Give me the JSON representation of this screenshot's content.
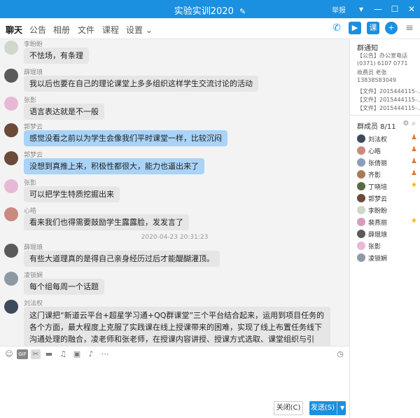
{
  "window": {
    "title": "实验实训2020",
    "report_label": "举报",
    "minimize": "—",
    "maximize": "☐",
    "close": "✕"
  },
  "tabs": [
    {
      "label": "聊天"
    },
    {
      "label": "公告"
    },
    {
      "label": "相册"
    },
    {
      "label": "文件"
    },
    {
      "label": "课程"
    },
    {
      "label": "设置 ⌄"
    }
  ],
  "messages": [
    {
      "sender": "李盼盼",
      "text": "不怯场，有条理"
    },
    {
      "sender": "薛琨琅",
      "text": "我以后也要在自己的理论课堂上多多组织这样学生交流讨论的活动"
    },
    {
      "sender": "张影",
      "text": "语言表达就是不一般"
    },
    {
      "sender": "郭梦云",
      "text": "感觉没看之前以为学生会像我们平时课堂一样，比较沉闷"
    },
    {
      "sender": "郭梦云",
      "text": "没想到真推上来，积极性都很大，能力也逼出来了"
    },
    {
      "sender": "张影",
      "text": "可以把学生特质挖掘出来"
    },
    {
      "sender": "心皓",
      "text": "看来我们也得需要鼓励学生露露脸，发发言了"
    },
    {
      "sender": "薛琨琅",
      "text": "有些大道理真的是得自己亲身经历过后才能醍醐灌顶。"
    },
    {
      "sender": "凌锁娴",
      "text": "每个组每周一个话题"
    },
    {
      "sender": "刘法权",
      "text": "这门课把“新道云平台+超星学习通+QQ群课堂”三个平台结合起来，运用到项目任务的各个方面，最大程度上克服了实践课在线上授课带来的困难，实现了线上布置任务线下沟通处理的融合，凌老师和张老师，在授课内容讲授、授课方式选取、课堂组织与引导、辅导答疑等方面，给我们树立了榜样，向你们学习！！"
    }
  ],
  "timestamp": "2020-04-23 20:31:23",
  "buttons": {
    "close": "关闭(C)",
    "send": "发送(S)"
  },
  "sidebar": {
    "notice_title": "群通知",
    "notice_lines": [
      "【公告】办公室电话",
      "(0371) 6107 0771",
      "收费员 老张",
      "13838583049"
    ],
    "files": [
      "【文件】2015444115-...",
      "【文件】2015444115-...",
      "【文件】2015444115-..."
    ],
    "members_title": "群成员 8/11",
    "members": [
      {
        "name": "刘法权",
        "role": "owner"
      },
      {
        "name": "心皓",
        "role": "owner"
      },
      {
        "name": "张倩丽",
        "role": "owner"
      },
      {
        "name": "齐影",
        "role": "owner"
      },
      {
        "name": "丁晓培",
        "role": "star"
      },
      {
        "name": "郭梦云",
        "role": ""
      },
      {
        "name": "李盼盼",
        "role": ""
      },
      {
        "name": "裴燕丽",
        "role": "star"
      },
      {
        "name": "薛琨琅",
        "role": ""
      },
      {
        "name": "张影",
        "role": ""
      },
      {
        "name": "凌锁娴",
        "role": ""
      }
    ]
  },
  "colors": {
    "accent": "#1b8fe0",
    "bubble": "#e6e6e6",
    "bubble_self": "#a9d3f7"
  }
}
